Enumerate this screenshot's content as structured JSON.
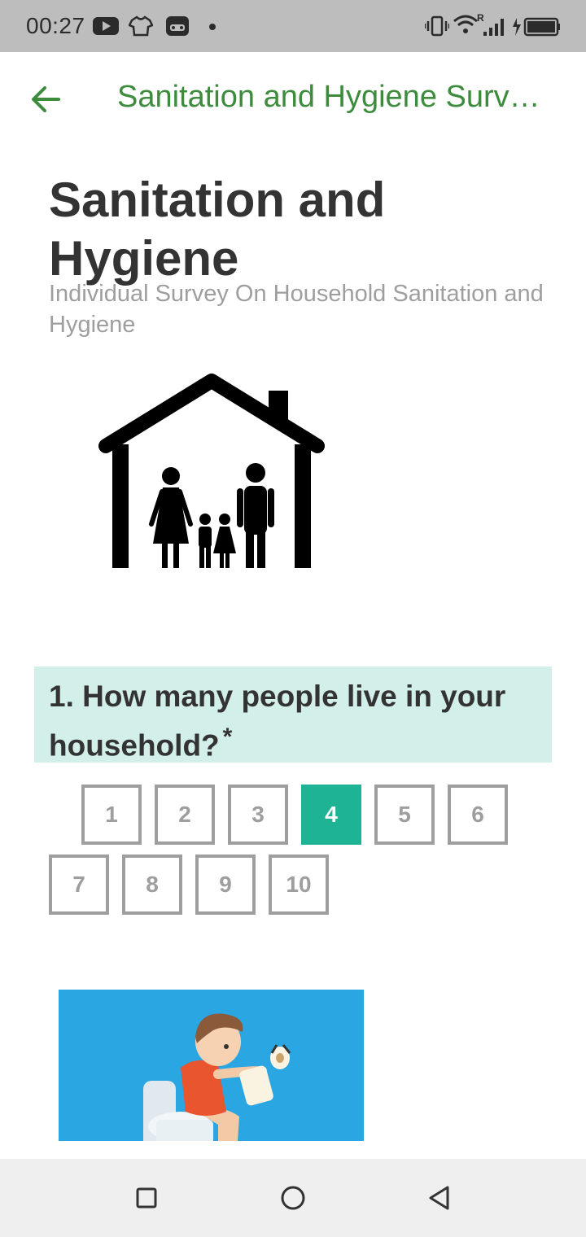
{
  "status_bar": {
    "time": "00:27",
    "icons": [
      "youtube-icon",
      "shirt-icon",
      "game-icon",
      "dot-icon",
      "vibrate-icon",
      "wifi-icon",
      "signal-icon",
      "battery-charging-icon"
    ]
  },
  "app_bar": {
    "title": "Sanitation and Hygiene Surv…",
    "back_icon": "arrow-left-icon"
  },
  "header": {
    "title": "Sanitation and Hygiene",
    "subtitle": "Individual Survey On Household Sanitation and Hygiene"
  },
  "question1": {
    "text": "1. How many people live in your household?",
    "required_mark": "*",
    "options": [
      "1",
      "2",
      "3",
      "4",
      "5",
      "6",
      "7",
      "8",
      "9",
      "10"
    ],
    "selected": "4"
  },
  "nav_bar": {
    "icons": [
      "recents-square-icon",
      "home-circle-icon",
      "back-triangle-icon"
    ]
  },
  "colors": {
    "accent_green": "#3d8b3d",
    "selected_option": "#1db394",
    "question_bg": "#d3efe9",
    "status_bar_bg": "#bdbdbd",
    "image_bg": "#2aa6e2"
  }
}
